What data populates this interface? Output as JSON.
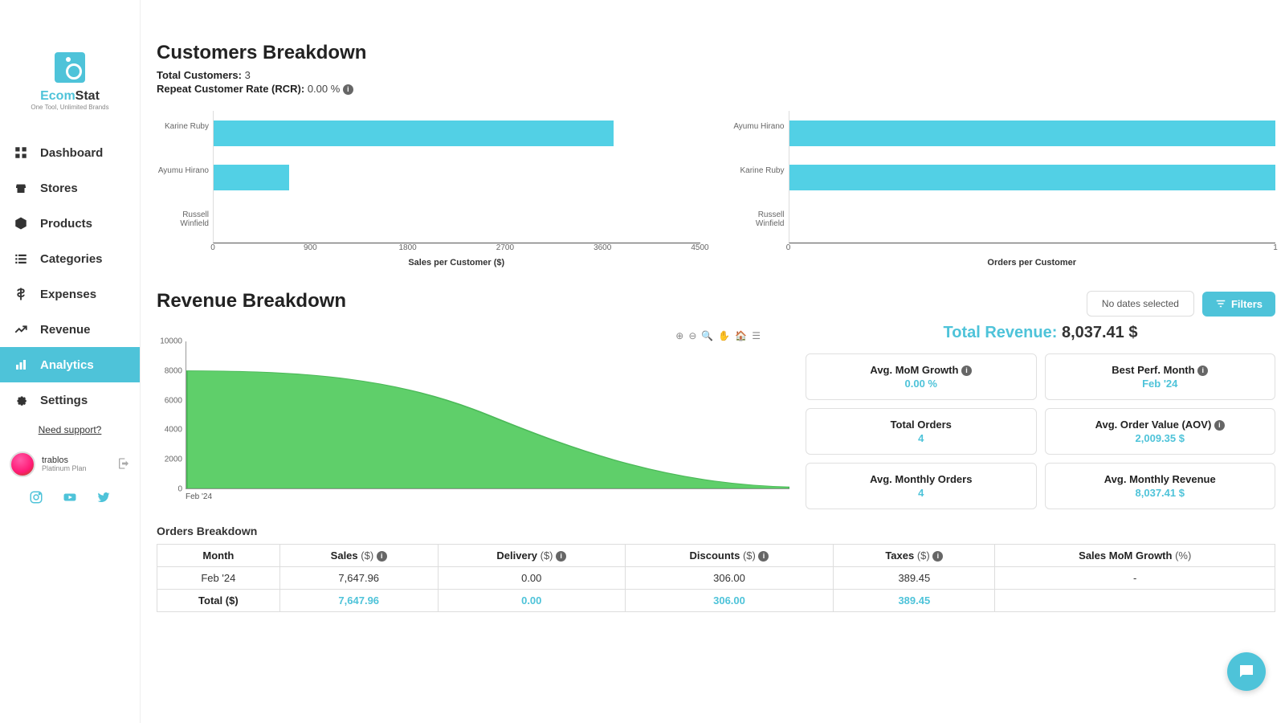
{
  "brand": {
    "name1": "Ecom",
    "name2": "Stat",
    "tag": "One Tool, Unlimited Brands"
  },
  "nav": {
    "dashboard": "Dashboard",
    "stores": "Stores",
    "products": "Products",
    "categories": "Categories",
    "expenses": "Expenses",
    "revenue": "Revenue",
    "analytics": "Analytics",
    "settings": "Settings"
  },
  "support": "Need support?",
  "user": {
    "name": "trablos",
    "plan": "Platinum Plan"
  },
  "customers": {
    "title": "Customers Breakdown",
    "total_label": "Total Customers:",
    "total_value": "3",
    "rcr_label": "Repeat Customer Rate (RCR):",
    "rcr_value": "0.00 %"
  },
  "revenue": {
    "title": "Revenue Breakdown",
    "no_dates": "No dates selected",
    "filters": "Filters",
    "total_label": "Total Revenue:",
    "total_value": "8,037.41 $",
    "xlabel": "Feb '24",
    "stats": {
      "mom": {
        "t": "Avg. MoM Growth",
        "v": "0.00 %"
      },
      "best": {
        "t": "Best Perf. Month",
        "v": "Feb '24"
      },
      "orders": {
        "t": "Total Orders",
        "v": "4"
      },
      "aov": {
        "t": "Avg. Order Value (AOV)",
        "v": "2,009.35 $"
      },
      "monthly_orders": {
        "t": "Avg. Monthly Orders",
        "v": "4"
      },
      "monthly_rev": {
        "t": "Avg. Monthly Revenue",
        "v": "8,037.41 $"
      }
    }
  },
  "orders": {
    "title": "Orders Breakdown",
    "cols": {
      "month": "Month",
      "sales": "Sales",
      "delivery": "Delivery",
      "discounts": "Discounts",
      "taxes": "Taxes",
      "growth": "Sales MoM Growth"
    },
    "unit": "($)",
    "pct": "(%)",
    "row": {
      "month": "Feb '24",
      "sales": "7,647.96",
      "delivery": "0.00",
      "discounts": "306.00",
      "taxes": "389.45",
      "growth": "-"
    },
    "total": {
      "label": "Total",
      "sales": "7,647.96",
      "delivery": "0.00",
      "discounts": "306.00",
      "taxes": "389.45"
    }
  },
  "chart_data": [
    {
      "type": "bar",
      "orientation": "horizontal",
      "title": "Sales per Customer ($)",
      "categories": [
        "Karine Ruby",
        "Ayumu Hirano",
        "Russell Winfield"
      ],
      "values": [
        3700,
        700,
        0
      ],
      "xlim": [
        0,
        4500
      ],
      "xticks": [
        0,
        900,
        1800,
        2700,
        3600,
        4500
      ],
      "xlabel": "Sales per Customer ($)"
    },
    {
      "type": "bar",
      "orientation": "horizontal",
      "title": "Orders per Customer",
      "categories": [
        "Ayumu Hirano",
        "Karine Ruby",
        "Russell Winfield"
      ],
      "values": [
        1,
        1,
        0
      ],
      "xlim": [
        0,
        1
      ],
      "xticks": [
        0,
        1
      ],
      "xlabel": "Orders per Customer"
    },
    {
      "type": "area",
      "title": "Revenue",
      "x": [
        "Feb '24"
      ],
      "values": [
        8037.41
      ],
      "ylim": [
        0,
        10000
      ],
      "yticks": [
        0,
        2000,
        4000,
        6000,
        8000,
        10000
      ]
    }
  ]
}
